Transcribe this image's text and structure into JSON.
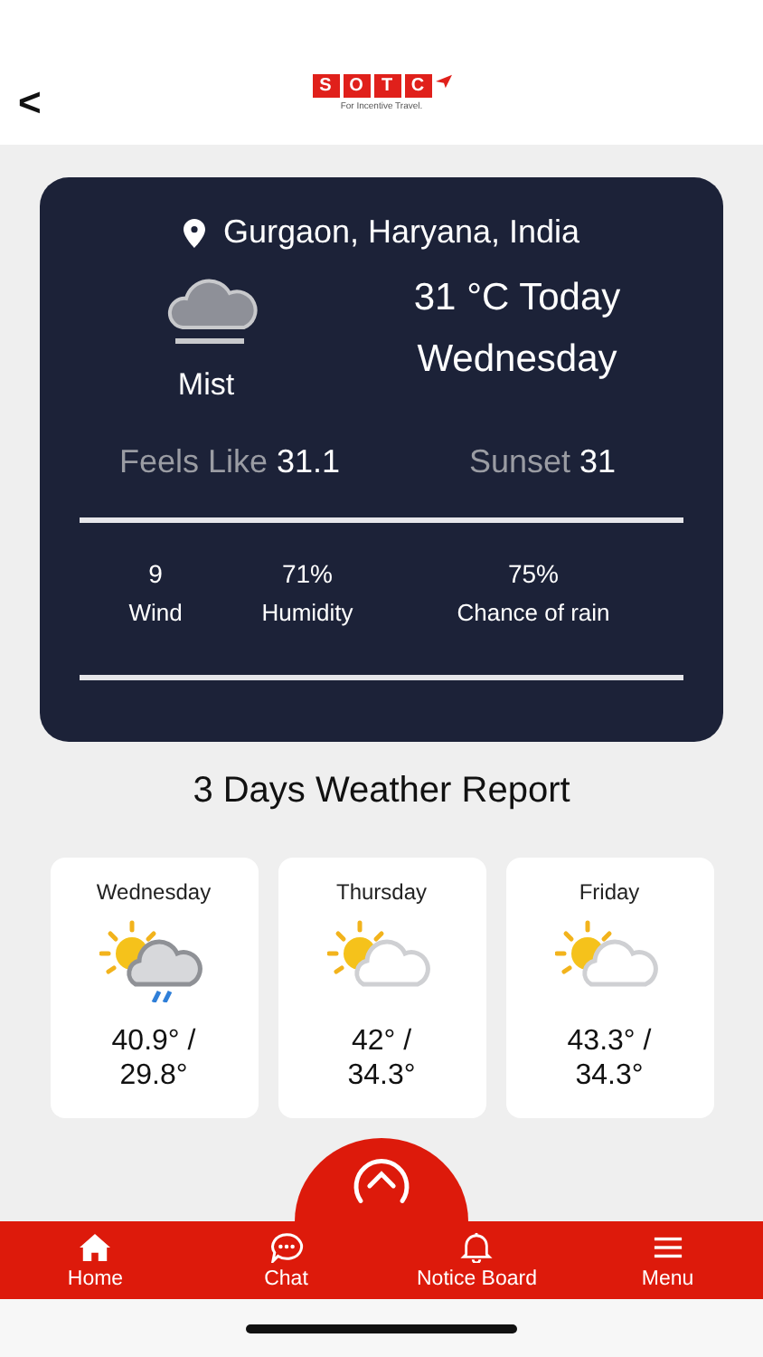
{
  "header": {
    "back": "<",
    "logo": {
      "letters": [
        "S",
        "O",
        "T",
        "C"
      ],
      "tagline": "For Incentive Travel."
    }
  },
  "current": {
    "location": "Gurgaon, Haryana, India",
    "condition": "Mist",
    "temperature": "31 °C Today",
    "day": "Wednesday",
    "feels_like_label": "Feels Like",
    "feels_like": "31.1",
    "sunset_label": "Sunset",
    "sunset": "31",
    "stats": [
      {
        "value": "9",
        "label": "Wind"
      },
      {
        "value": "71%",
        "label": "Humidity"
      },
      {
        "value": "75%",
        "label": "Chance of rain"
      }
    ]
  },
  "forecast_title": "3 Days Weather Report",
  "forecast": [
    {
      "day": "Wednesday",
      "kind": "rain",
      "high": "40.9° /",
      "low": "29.8°"
    },
    {
      "day": "Thursday",
      "kind": "partly-cloudy",
      "high": "42° /",
      "low": "34.3°"
    },
    {
      "day": "Friday",
      "kind": "partly-cloudy",
      "high": "43.3° /",
      "low": "34.3°"
    }
  ],
  "nav": [
    {
      "kind": "home",
      "label": "Home"
    },
    {
      "kind": "chat",
      "label": "Chat"
    },
    {
      "kind": "bell",
      "label": "Notice Board"
    },
    {
      "kind": "menu",
      "label": "Menu"
    }
  ]
}
